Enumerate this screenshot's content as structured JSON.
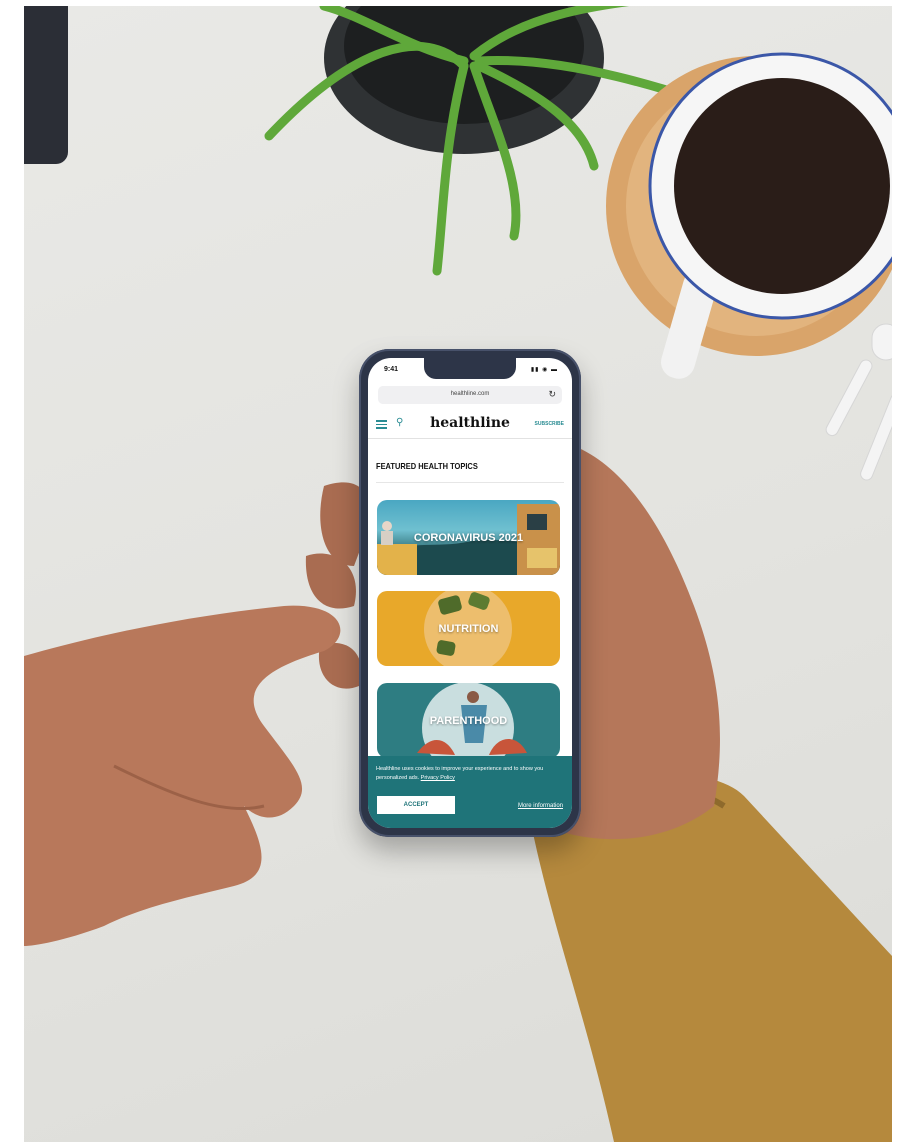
{
  "status_bar": {
    "time": "9:41",
    "signal_icons": "signal-wifi-battery-icons"
  },
  "browser": {
    "url": "healthline.com",
    "reload_icon": "reload-icon"
  },
  "site_header": {
    "logo": "healthline",
    "subscribe_label": "SUBSCRIBE",
    "menu_icon": "hamburger-menu-icon",
    "search_icon": "search-icon"
  },
  "featured": {
    "title": "FEATURED HEALTH TOPICS",
    "topics": [
      {
        "label": "CORONAVIRUS 2021"
      },
      {
        "label": "NUTRITION"
      },
      {
        "label": "PARENTHOOD"
      }
    ]
  },
  "cookie_banner": {
    "text_prefix": "Healthline uses cookies to improve your experience and to show you personalized ads.",
    "privacy_link": "Privacy Policy",
    "accept_label": "ACCEPT",
    "more_info_label": "More information"
  },
  "colors": {
    "accent": "#2a8c93",
    "banner": "#1f7479",
    "nutrition_card": "#e8a82a",
    "parenthood_card": "#2e7d82"
  }
}
